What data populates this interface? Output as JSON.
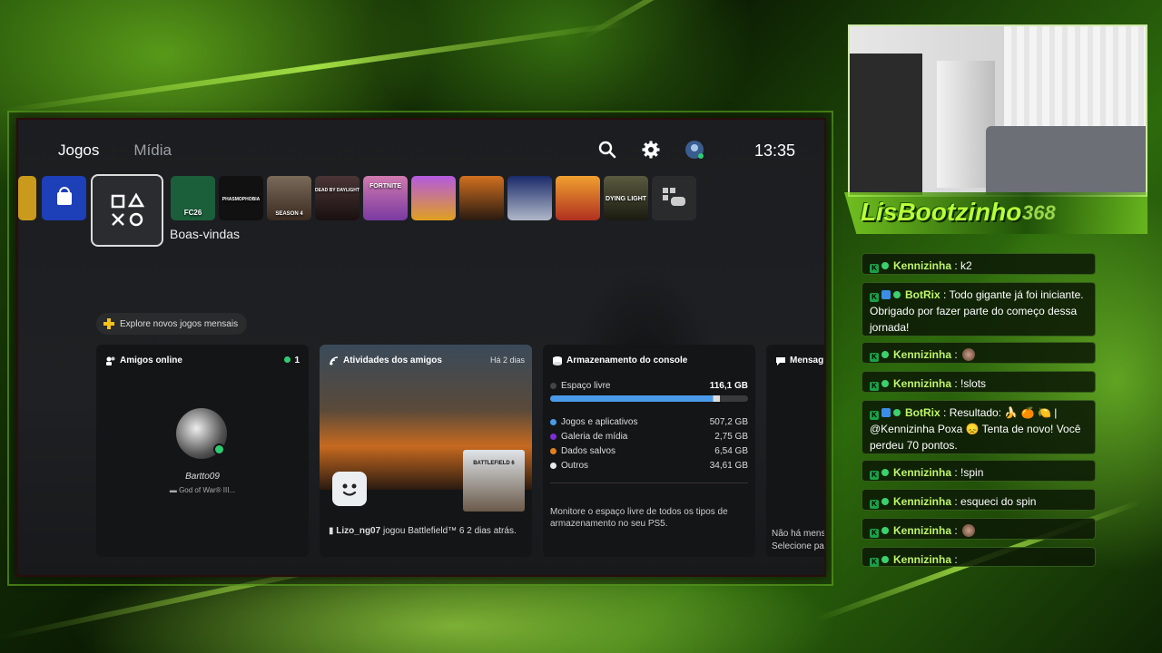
{
  "ps5": {
    "tabs": [
      "Jogos",
      "Mídia"
    ],
    "clock": "13:35",
    "icons": [
      "search-icon",
      "gear-icon",
      "avatar"
    ],
    "tiles": [
      {
        "label": "",
        "color": "#c99a1b"
      },
      {
        "label": "",
        "color": "#1d3fb8"
      },
      {
        "label": "FC26",
        "color": "#1b5e3a"
      },
      {
        "label": "PHASMOPHOBIA",
        "color": "#111111"
      },
      {
        "label": "SEASON 4",
        "color": "#5a4a3c"
      },
      {
        "label": "DEAD BY DAYLIGHT",
        "color": "#3a2a2a"
      },
      {
        "label": "FORTNITE",
        "color": "#b0578f"
      },
      {
        "label": "",
        "color": "#8a3fc4"
      },
      {
        "label": "",
        "color": "#c26a1f"
      },
      {
        "label": "",
        "color": "#2d5da0"
      },
      {
        "label": "",
        "color": "#d06a20"
      },
      {
        "label": "DYING LIGHT",
        "color": "#3a3a2a"
      },
      {
        "label": "",
        "color": "#2a2b2d"
      }
    ],
    "home_label": "Boas-vindas",
    "explore_label": "Explore novos jogos mensais",
    "friends_card": {
      "title": "Amigos online",
      "count": "1",
      "friend_name": "Bartto09",
      "friend_game": "God of War® III..."
    },
    "activity_card": {
      "title": "Atividades dos amigos",
      "time": "Há 2 dias",
      "game_title": "BATTLEFIELD 6",
      "user": "Lizo_ng07",
      "text": " jogou Battlefield™ 6 2 dias atrás."
    },
    "storage_card": {
      "title": "Armazenamento do console",
      "free_label": "Espaço livre",
      "free_value": "116,1 GB",
      "used_fraction": 0.86,
      "items": [
        {
          "label": "Jogos e aplicativos",
          "value": "507,2 GB",
          "color": "#4a9ae8"
        },
        {
          "label": "Galeria de mídia",
          "value": "2,75 GB",
          "color": "#7b2fd6"
        },
        {
          "label": "Dados salvos",
          "value": "6,54 GB",
          "color": "#e2801e"
        },
        {
          "label": "Outros",
          "value": "34,61 GB",
          "color": "#e8e8e8"
        }
      ],
      "footer": "Monitore o espaço livre de todos os tipos de armazenamento no seu PS5."
    },
    "messages_card": {
      "title": "Mensag",
      "line1": "Não há mens",
      "line2": "Selecione pa"
    }
  },
  "stream": {
    "channel_name": "LisBootzinho",
    "count": "368",
    "chat": [
      {
        "user": "Kennizinha",
        "msg": "k2",
        "bot": false
      },
      {
        "user": "BotRix",
        "msg": "Todo gigante já foi iniciante. Obrigado por fazer parte do começo dessa jornada!",
        "bot": true
      },
      {
        "user": "Kennizinha",
        "msg": "",
        "bot": false,
        "emote": true
      },
      {
        "user": "Kennizinha",
        "msg": "!slots",
        "bot": false
      },
      {
        "user": "BotRix",
        "msg": "Resultado: 🍌 🍊 🍋 | @Kennizinha Poxa 😞 Tenta de novo! Você perdeu 70 pontos.",
        "bot": true
      },
      {
        "user": "Kennizinha",
        "msg": "!spin",
        "bot": false
      },
      {
        "user": "Kennizinha",
        "msg": "esqueci do spin",
        "bot": false
      },
      {
        "user": "Kennizinha",
        "msg": "",
        "bot": false,
        "emote": true
      },
      {
        "user": "Kennizinha",
        "msg": "",
        "bot": false
      }
    ]
  }
}
